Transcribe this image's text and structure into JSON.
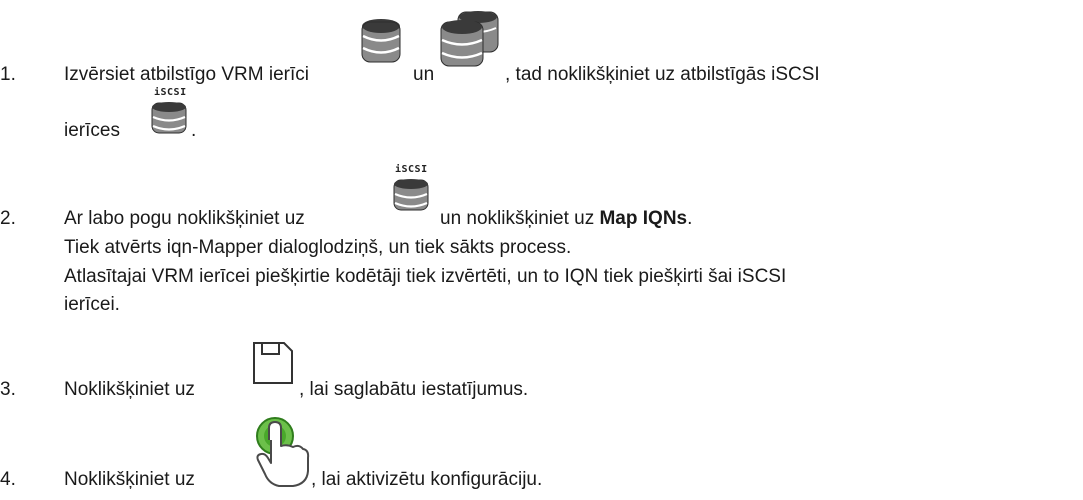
{
  "steps": [
    {
      "number": "1.",
      "text_a": "Izvērsiet atbilstīgo VRM ierīci",
      "text_b": "un",
      "text_c": ", tad noklikšķiniet uz atbilstīgās iSCSI",
      "text_d": "ierīces",
      "text_e": "."
    },
    {
      "number": "2.",
      "text_a": "Ar labo pogu noklikšķiniet uz",
      "text_b": "un noklikšķiniet uz",
      "text_bold": "Map IQNs",
      "text_end": ".",
      "line2": "Tiek atvērts iqn-Mapper dialoglodziņš, un tiek sākts process.",
      "line3": "Atlasītajai VRM ierīcei piešķirtie kodētāji tiek izvērtēti, un to IQN tiek piešķirti šai iSCSI",
      "line4": "ierīcei."
    },
    {
      "number": "3.",
      "text_a": "Noklikšķiniet uz",
      "text_b": ", lai saglabātu iestatījumus."
    },
    {
      "number": "4.",
      "text_a": "Noklikšķiniet uz",
      "text_b": ", lai aktivizētu konfigurāciju."
    }
  ],
  "icons": {
    "iscsi_label": "iSCSI"
  }
}
